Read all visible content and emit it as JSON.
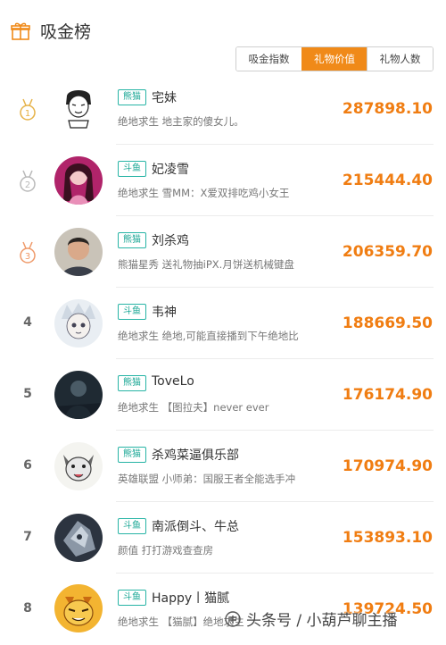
{
  "header": {
    "title": "吸金榜",
    "icon": "gift-icon"
  },
  "tabs": [
    {
      "label": "吸金指数",
      "active": false
    },
    {
      "label": "礼物价值",
      "active": true
    },
    {
      "label": "礼物人数",
      "active": false
    }
  ],
  "colors": {
    "accent": "#f08a19",
    "value": "#f07d12",
    "badge": "#27b4a5"
  },
  "rows": [
    {
      "rank": "1",
      "medal": "gold",
      "badge": "熊猫",
      "name": "宅妹",
      "desc": "绝地求生 地主家的傻女儿。",
      "value": "287898.10"
    },
    {
      "rank": "2",
      "medal": "silver",
      "badge": "斗鱼",
      "name": "妃凌雪",
      "desc": "绝地求生 雪MM：X爱双排吃鸡小女王",
      "value": "215444.40"
    },
    {
      "rank": "3",
      "medal": "bronze",
      "badge": "熊猫",
      "name": "刘杀鸡",
      "desc": "熊猫星秀 送礼物抽iPX.月饼送机械键盘",
      "value": "206359.70"
    },
    {
      "rank": "4",
      "badge": "斗鱼",
      "name": "韦神",
      "desc": "绝地求生 绝地,可能直接播到下午绝地比",
      "value": "188669.50"
    },
    {
      "rank": "5",
      "badge": "熊猫",
      "name": "ToveLo",
      "desc": "绝地求生 【图拉夫】never ever",
      "value": "176174.90"
    },
    {
      "rank": "6",
      "badge": "熊猫",
      "name": "杀鸡菜逼俱乐部",
      "desc": "英雄联盟 小师弟：国服王者全能选手冲",
      "value": "170974.90"
    },
    {
      "rank": "7",
      "badge": "斗鱼",
      "name": "南派倒斗、牛总",
      "desc": "颜值 打打游戏查查房",
      "value": "153893.10"
    },
    {
      "rank": "8",
      "badge": "斗鱼",
      "name": "Happy丨猫腻",
      "desc": "绝地求生 【猫腻】绝地求生",
      "value": "139724.50"
    }
  ],
  "watermark": {
    "text": "头条号 / 小葫芦聊主播"
  }
}
